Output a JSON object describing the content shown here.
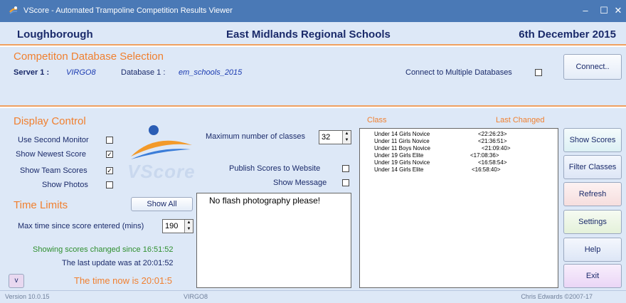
{
  "window": {
    "title": "VScore - Automated Trampoline Competition Results Viewer",
    "minimize_glyph": "–",
    "maximize_glyph": "☐",
    "close_glyph": "✕"
  },
  "header": {
    "location": "Loughborough",
    "event": "East Midlands Regional Schools",
    "date": "6th December 2015"
  },
  "database_section": {
    "heading": "Competiton Database Selection",
    "server_label": "Server 1 :",
    "server_value": "VIRGO8",
    "database_label": "Database 1 :",
    "database_value": "em_schools_2015",
    "multi_label": "Connect to Multiple Databases",
    "multi_checked": false,
    "connect_label": "Connect.."
  },
  "display_control": {
    "heading": "Display Control",
    "use_second_monitor": {
      "label": "Use Second Monitor",
      "checked": false
    },
    "show_newest_score": {
      "label": "Show Newest Score",
      "checked": true
    },
    "show_team_scores": {
      "label": "Show Team Scores",
      "checked": true
    },
    "show_photos": {
      "label": "Show Photos",
      "checked": false
    },
    "max_classes_label": "Maximum number of classes",
    "max_classes_value": "32",
    "publish_label": "Publish Scores to Website",
    "publish_checked": false,
    "show_message_label": "Show Message",
    "show_message_checked": false,
    "logo_text": "VScore"
  },
  "time_limits": {
    "heading": "Time Limits",
    "show_all_label": "Show All",
    "max_time_label": "Max time since score entered (mins)",
    "max_time_value": "190",
    "showing_since": "Showing scores changed since 16:51:52",
    "last_update": "The last update was at 20:01:52",
    "time_now": "The time now is 20:01:5",
    "v_button": "v"
  },
  "message_box": {
    "text": "No flash photography please!"
  },
  "class_list": {
    "col_class": "Class",
    "col_last_changed": "Last Changed",
    "rows": [
      {
        "name": "Under 14 Girls Novice",
        "time": "<22:26:23>"
      },
      {
        "name": "Under 11 Girls Novice",
        "time": "<21:36:51>"
      },
      {
        "name": "Under 11 Boys Novice",
        "time": "<21:09:40>"
      },
      {
        "name": "Under 19 Girls Elite",
        "time": "<17:08:36>"
      },
      {
        "name": "Under 19 Girls Novice",
        "time": "<16:58:54>"
      },
      {
        "name": "Under 14 Girls Elite",
        "time": "<16:58:40>"
      }
    ]
  },
  "side_buttons": {
    "show_scores": "Show Scores",
    "filter_classes": "Filter Classes",
    "refresh": "Refresh",
    "settings": "Settings",
    "help": "Help",
    "exit": "Exit"
  },
  "status": {
    "version": "Version 10.0.15",
    "server": "VIRGO8",
    "copyright": "Chris Edwards ©2007-17"
  },
  "colors": {
    "titlebar": "#4a79b6",
    "panel": "#dde8f7",
    "accent_orange": "#f08030",
    "text_navy": "#1a2a6a",
    "status_green": "#2f8f2f"
  }
}
